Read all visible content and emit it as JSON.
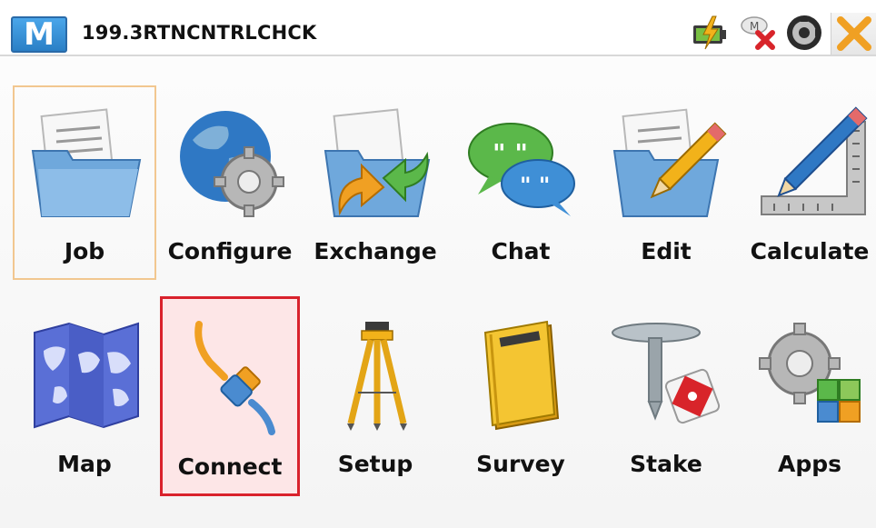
{
  "window": {
    "logo_text": "M",
    "job_name": "199.3RTNCNTRLCHCK"
  },
  "status_icons": [
    "battery-charging-icon",
    "no-connection-icon",
    "gps-status-icon",
    "close-icon"
  ],
  "menu": {
    "row1": [
      {
        "label": "Job",
        "icon": "job-folder-icon"
      },
      {
        "label": "Configure",
        "icon": "configure-globe-gear-icon"
      },
      {
        "label": "Exchange",
        "icon": "exchange-folder-arrows-icon"
      },
      {
        "label": "Chat",
        "icon": "chat-bubbles-icon"
      },
      {
        "label": "Edit",
        "icon": "edit-folder-pencil-icon"
      },
      {
        "label": "Calculate",
        "icon": "calculate-square-pencil-icon"
      }
    ],
    "row2": [
      {
        "label": "Map",
        "icon": "map-icon"
      },
      {
        "label": "Connect",
        "icon": "connect-cable-icon"
      },
      {
        "label": "Setup",
        "icon": "setup-tripod-icon"
      },
      {
        "label": "Survey",
        "icon": "survey-notebook-icon"
      },
      {
        "label": "Stake",
        "icon": "stake-marker-icon"
      },
      {
        "label": "Apps",
        "icon": "apps-gear-blocks-icon"
      }
    ]
  }
}
